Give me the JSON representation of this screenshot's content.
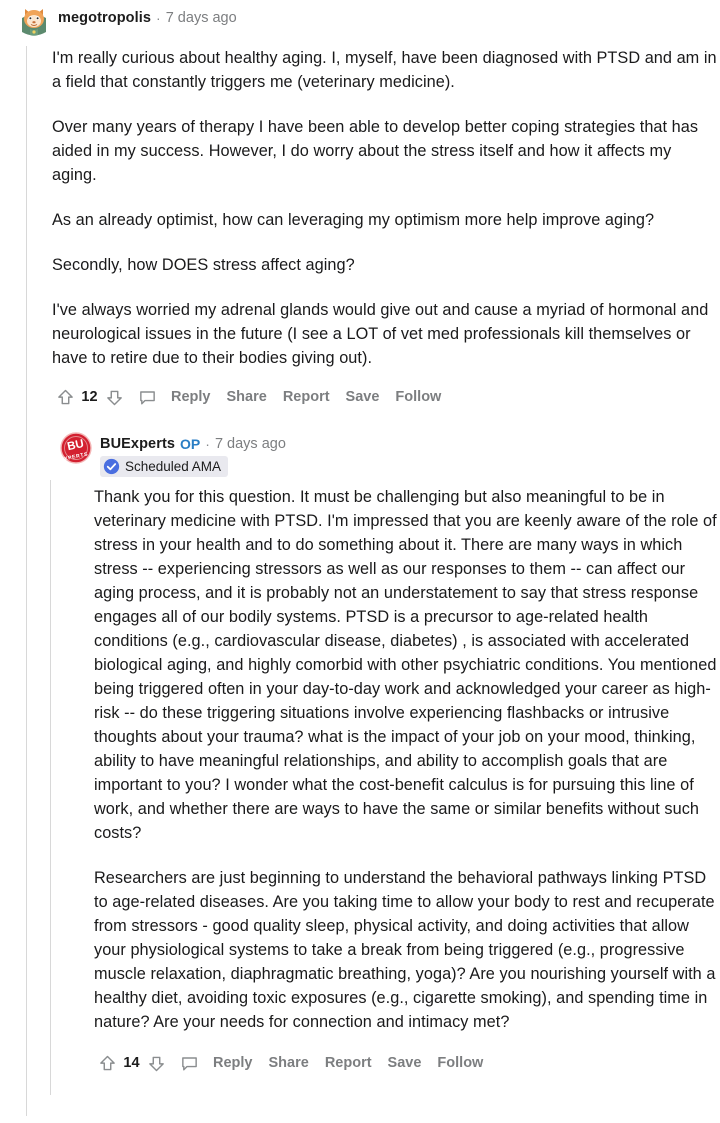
{
  "thread": {
    "comments": [
      {
        "author": "megotropolis",
        "separator": "·",
        "timestamp": "7 days ago",
        "avatar_icon": "snoo-avatar",
        "paragraphs": [
          "I'm really curious about healthy aging. I, myself, have been diagnosed with PTSD and am in a field that constantly triggers me (veterinary medicine).",
          "Over many years of therapy I have been able to develop better coping strategies that has aided in my success. However, I do worry about the stress itself and how it affects my aging.",
          "As an already optimist, how can leveraging my optimism more help improve aging?",
          "Secondly, how DOES stress affect aging?",
          "I've always worried my adrenal glands would give out and cause a myriad of hormonal and neurological issues in the future (I see a LOT of vet med professionals kill themselves or have to retire due to their bodies giving out)."
        ],
        "actions": {
          "upvote_icon": "upvote-arrow-icon",
          "vote_count": "12",
          "downvote_icon": "downvote-arrow-icon",
          "comment_icon": "comment-bubble-icon",
          "reply": "Reply",
          "share": "Share",
          "report": "Report",
          "save": "Save",
          "follow": "Follow"
        }
      },
      {
        "author": "BUExperts",
        "op_badge": "OP",
        "separator": "·",
        "timestamp": "7 days ago",
        "avatar_icon": "bu-experts-logo",
        "flair": {
          "label": "Scheduled AMA",
          "icon": "verified-check-icon"
        },
        "paragraphs": [
          "Thank you for this question. It must be challenging but also meaningful to be in veterinary medicine with PTSD. I'm impressed that you are keenly aware of the role of stress in your health and to do something about it. There are many ways in which stress -- experiencing stressors as well as our responses to them -- can affect our aging process, and it is probably not an understatement to say that stress response engages all of our bodily systems. PTSD is a precursor to age-related health conditions (e.g., cardiovascular disease, diabetes) , is associated with accelerated biological aging, and highly comorbid with other psychiatric conditions. You mentioned being triggered often in your day-to-day work and acknowledged your career as high-risk -- do these triggering situations involve experiencing flashbacks or intrusive thoughts about your trauma? what is the impact of your job on your mood, thinking, ability to have meaningful relationships, and ability to accomplish goals that are important to you? I wonder what the cost-benefit calculus is for pursuing this line of work, and whether there are ways to have the same or similar benefits without such costs?",
          "Researchers are just beginning to understand the behavioral pathways linking PTSD to age-related diseases. Are you taking time to allow your body to rest and recuperate from stressors - good quality sleep, physical activity, and doing activities that allow your physiological systems to take a break from being triggered (e.g., progressive muscle relaxation, diaphragmatic breathing, yoga)? Are you nourishing yourself with a healthy diet, avoiding toxic exposures (e.g., cigarette smoking), and spending time in nature? Are your needs for connection and intimacy met?"
        ],
        "actions": {
          "upvote_icon": "upvote-arrow-icon",
          "vote_count": "14",
          "downvote_icon": "downvote-arrow-icon",
          "comment_icon": "comment-bubble-icon",
          "reply": "Reply",
          "share": "Share",
          "report": "Report",
          "save": "Save",
          "follow": "Follow"
        }
      }
    ]
  },
  "colors": {
    "op_blue": "#2a7ec4",
    "flair_bg": "#e9e9ef",
    "verified_blue": "#4a6ee0",
    "bu_red": "#d32030",
    "thread_line": "#d8d8d8",
    "muted_text": "#7c7e80",
    "body_text": "#1a1a1b"
  }
}
